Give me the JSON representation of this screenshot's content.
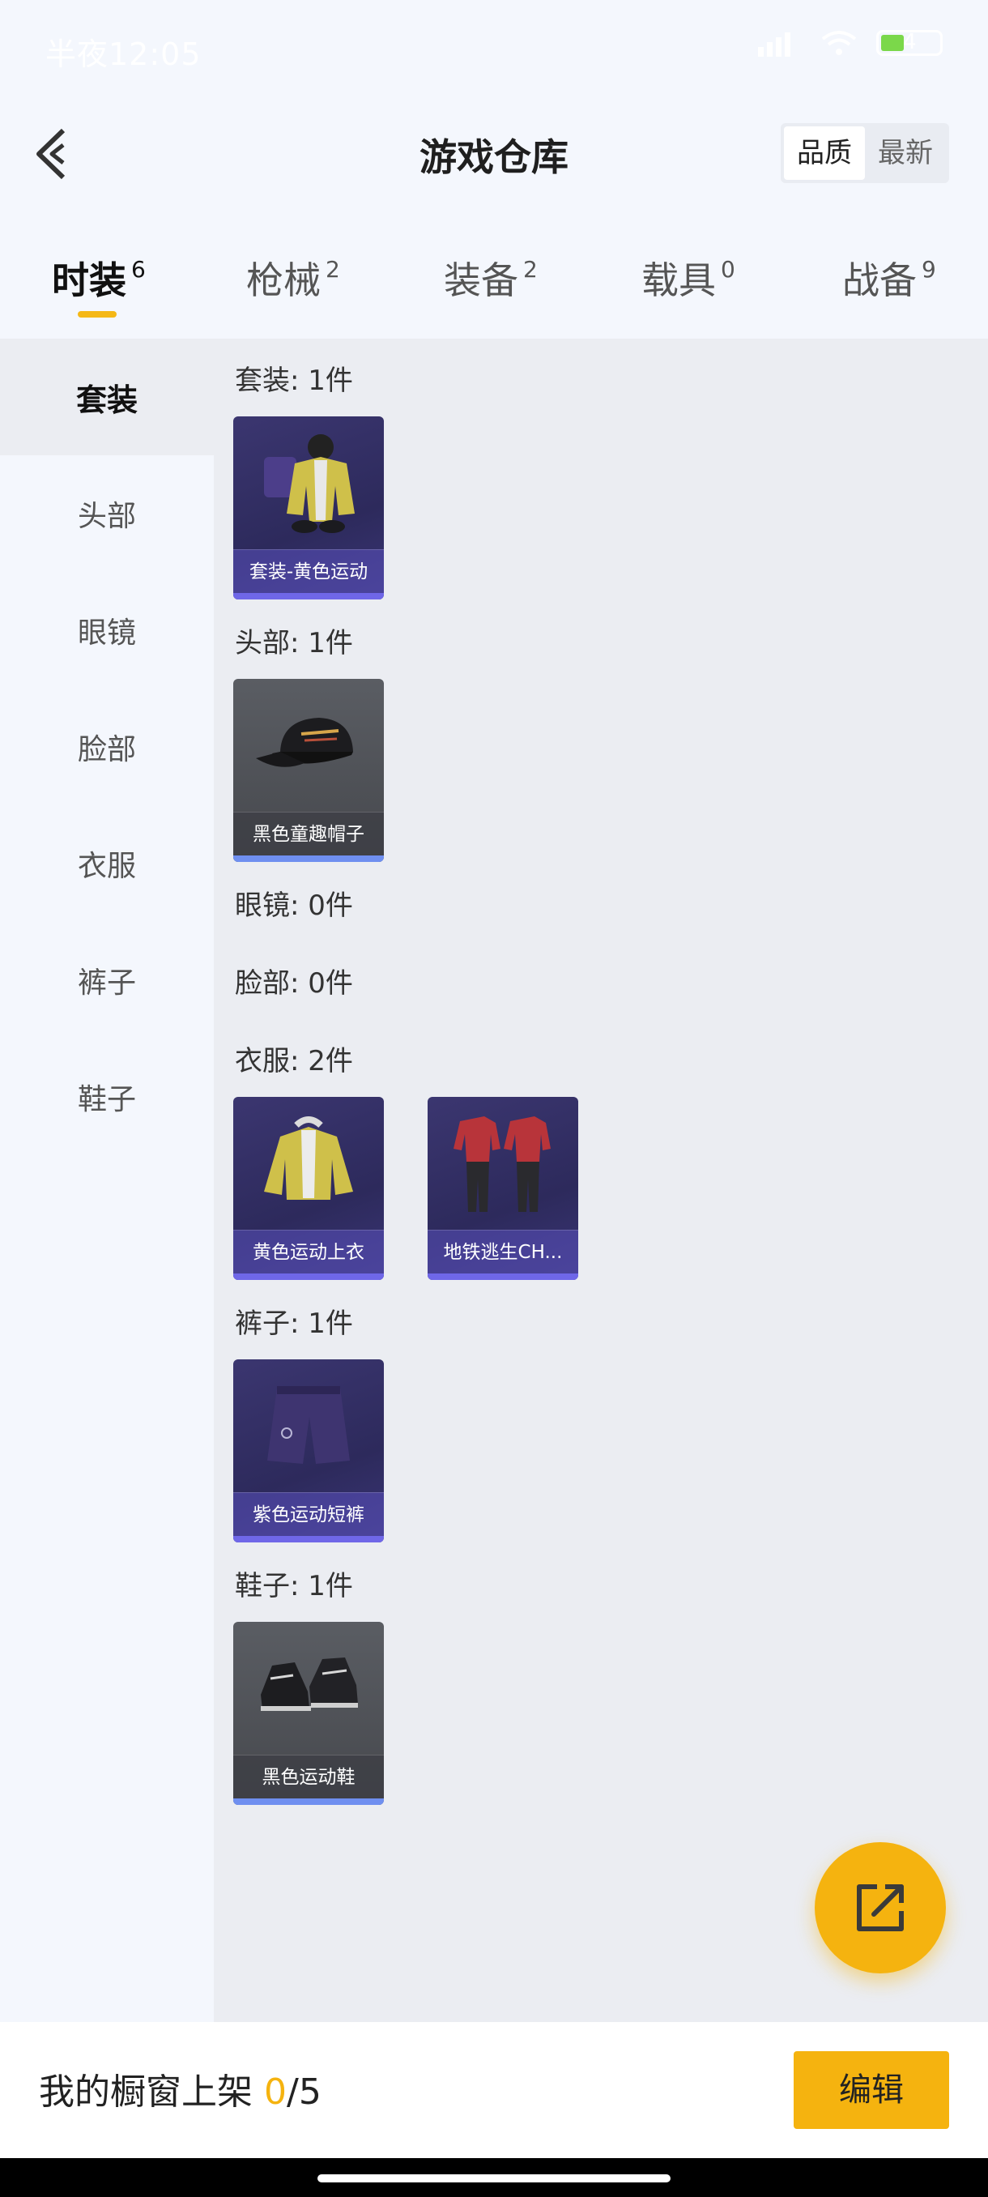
{
  "status_bar": {
    "time": "半夜12:05",
    "battery_level": "4"
  },
  "header": {
    "title": "游戏仓库",
    "sort_options": [
      "品质",
      "最新"
    ],
    "sort_selected": "品质"
  },
  "tabs": [
    {
      "label": "时装",
      "count": "6"
    },
    {
      "label": "枪械",
      "count": "2"
    },
    {
      "label": "装备",
      "count": "2"
    },
    {
      "label": "载具",
      "count": "0"
    },
    {
      "label": "战备",
      "count": "9"
    }
  ],
  "sidebar": {
    "items": [
      "套装",
      "头部",
      "眼镜",
      "脸部",
      "衣服",
      "裤子",
      "鞋子"
    ]
  },
  "sections": [
    {
      "title": "套装: 1件",
      "items": [
        "套装-黄色运动"
      ]
    },
    {
      "title": "头部: 1件",
      "items": [
        "黑色童趣帽子"
      ]
    },
    {
      "title": "眼镜: 0件",
      "items": []
    },
    {
      "title": "脸部: 0件",
      "items": []
    },
    {
      "title": "衣服: 2件",
      "items": [
        "黄色运动上衣",
        "地铁逃生CH..."
      ]
    },
    {
      "title": "裤子: 1件",
      "items": [
        "紫色运动短裤"
      ]
    },
    {
      "title": "鞋子: 1件",
      "items": [
        "黑色运动鞋"
      ]
    }
  ],
  "bottom_bar": {
    "label": "我的橱窗上架 ",
    "count": "0",
    "total": "/5",
    "edit_label": "编辑"
  },
  "colors": {
    "accent": "#f5b30f",
    "card_purple": "#3b3670",
    "card_gray": "#55585e"
  }
}
